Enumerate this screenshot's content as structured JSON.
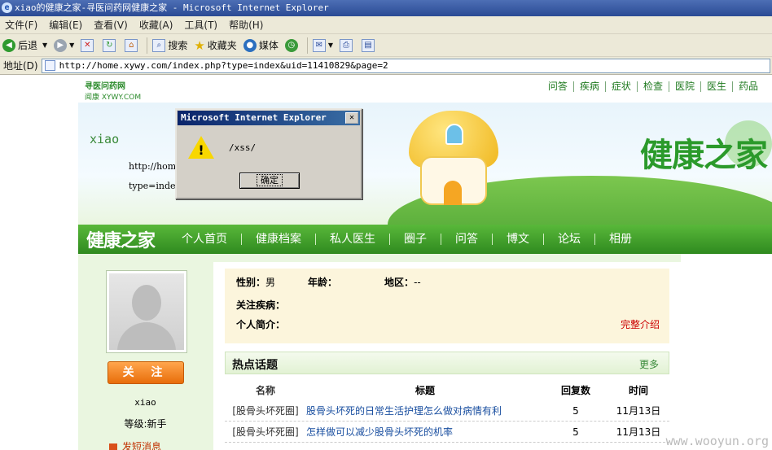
{
  "window": {
    "title": "xiao的健康之家-寻医问药网健康之家 - Microsoft Internet Explorer"
  },
  "menu": [
    "文件(F)",
    "编辑(E)",
    "查看(V)",
    "收藏(A)",
    "工具(T)",
    "帮助(H)"
  ],
  "toolbar": {
    "back": "后退",
    "search": "搜索",
    "favorites": "收藏夹",
    "media": "媒体"
  },
  "address": {
    "label": "地址(D)",
    "url": "http://home.xywy.com/index.php?type=index&uid=11410829&page=2"
  },
  "site": {
    "logo_line1": "寻医问药网",
    "logo_line2": "闻康 XYWY.COM",
    "top_links": [
      "问答",
      "疾病",
      "症状",
      "检查",
      "医院",
      "医生",
      "药品"
    ],
    "banner_user": "xiao",
    "banner_url1": "http://hom",
    "banner_url2": "type=index",
    "banner_brand": "健康之家",
    "nav_logo": "健康之家",
    "nav_items": [
      "个人首页",
      "健康档案",
      "私人医生",
      "圈子",
      "问答",
      "博文",
      "论坛",
      "相册"
    ]
  },
  "profile": {
    "follow_label": "关 注",
    "username": "xiao",
    "level": "等级:新手",
    "message_link": "发短消息",
    "gender_label": "性别：",
    "gender_value": "男",
    "age_label": "年龄：",
    "age_value": "",
    "region_label": "地区：",
    "region_value": "--",
    "disease_label": "关注疾病：",
    "intro_label": "个人简介：",
    "complete_link": "完整介绍"
  },
  "hot": {
    "title": "热点话题",
    "more": "更多",
    "columns": [
      "名称",
      "标题",
      "回复数",
      "时间"
    ],
    "rows": [
      {
        "group": "[股骨头坏死圈]",
        "title": "股骨头坏死的日常生活护理怎么做对病情有利",
        "replies": "5",
        "time": "11月13日"
      },
      {
        "group": "[股骨头坏死圈]",
        "title": "怎样做可以减少股骨头坏死的机率",
        "replies": "5",
        "time": "11月13日"
      }
    ]
  },
  "dialog": {
    "title": "Microsoft Internet Explorer",
    "message": "/xss/",
    "ok": "确定"
  },
  "watermark": "www.wooyun.org"
}
